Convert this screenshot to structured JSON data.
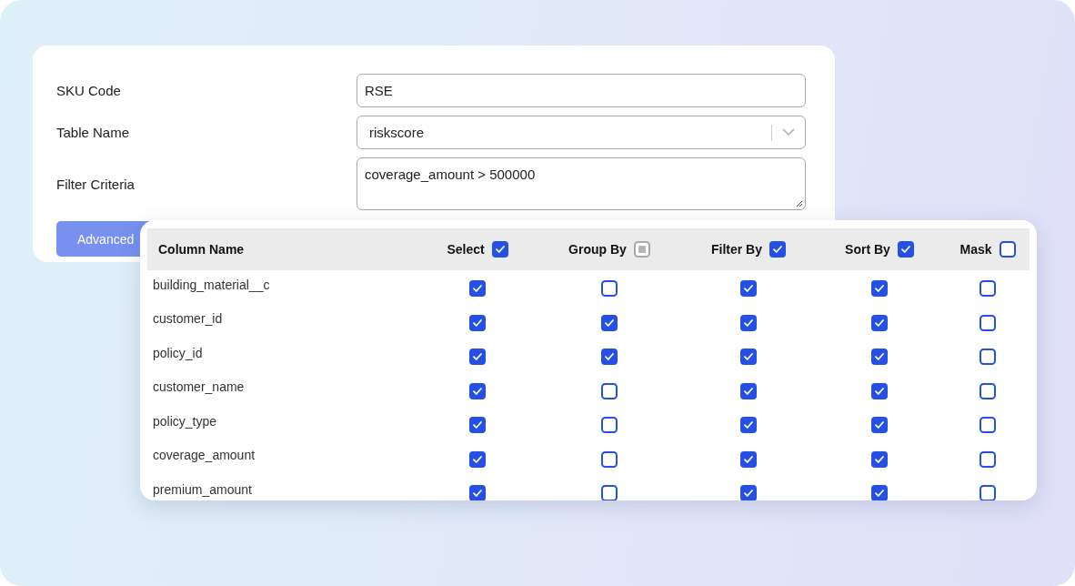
{
  "form": {
    "fields": [
      {
        "label": "SKU Code",
        "kind": "text",
        "value": "RSE"
      },
      {
        "label": "Table Name",
        "kind": "select",
        "value": "riskscore"
      },
      {
        "label": "Filter Criteria",
        "kind": "textarea",
        "value": "coverage_amount > 500000"
      }
    ],
    "button": "Advanced"
  },
  "table": {
    "name_header": "Column Name",
    "columns": [
      {
        "label": "Select",
        "checked": true,
        "indeterminate": false
      },
      {
        "label": "Group By",
        "checked": false,
        "indeterminate": true
      },
      {
        "label": "Filter By",
        "checked": true,
        "indeterminate": false
      },
      {
        "label": "Sort By",
        "checked": true,
        "indeterminate": false
      },
      {
        "label": "Mask",
        "checked": false,
        "indeterminate": false
      }
    ],
    "rows": [
      {
        "name": "building_material__c",
        "checks": [
          true,
          false,
          true,
          true,
          false
        ]
      },
      {
        "name": "customer_id",
        "checks": [
          true,
          true,
          true,
          true,
          false
        ]
      },
      {
        "name": "policy_id",
        "checks": [
          true,
          true,
          true,
          true,
          false
        ]
      },
      {
        "name": "customer_name",
        "checks": [
          true,
          false,
          true,
          true,
          false
        ]
      },
      {
        "name": "policy_type",
        "checks": [
          true,
          false,
          true,
          true,
          false
        ]
      },
      {
        "name": "coverage_amount",
        "checks": [
          true,
          false,
          true,
          true,
          false
        ]
      },
      {
        "name": "premium_amount",
        "checks": [
          true,
          false,
          true,
          true,
          false
        ]
      }
    ]
  }
}
